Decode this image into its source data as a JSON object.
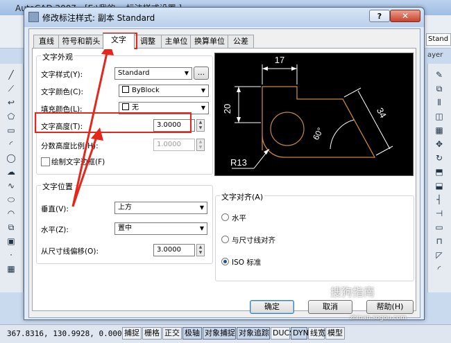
{
  "cad": {
    "title": "AutoCAD 2007 - [E:\\我的... 标注样式设置 ]",
    "coords": "367.8316, 130.9928, 0.0000",
    "status_buttons": [
      "捕捉",
      "栅格",
      "正交",
      "极轴",
      "对象捕捉",
      "对象追踪",
      "DUCS",
      "DYN",
      "线宽",
      "模型"
    ],
    "toolbar_right_label": "Stand",
    "layer_label": "ayer"
  },
  "dialog": {
    "title": "修改标注样式: 副本 Standard",
    "help": "?",
    "close": "✕",
    "tabs": [
      "直线",
      "符号和箭头",
      "文字",
      "调整",
      "主单位",
      "换算单位",
      "公差"
    ],
    "active_tab": "文字",
    "text_appearance": {
      "group": "文字外观",
      "style_label": "文字样式(Y):",
      "style_value": "Standard",
      "style_more": "...",
      "color_label": "文字颜色(C):",
      "color_value": "ByBlock",
      "fill_label": "填充颜色(L):",
      "fill_value": "无",
      "height_label": "文字高度(T):",
      "height_value": "3.0000",
      "fraction_label": "分数高度比例(H):",
      "fraction_value": "1.0000",
      "frame_label": "绘制文字边框(F)"
    },
    "text_placement": {
      "group": "文字位置",
      "vertical_label": "垂直(V):",
      "vertical_value": "上方",
      "horizontal_label": "水平(Z):",
      "horizontal_value": "置中",
      "offset_label": "从尺寸线偏移(O):",
      "offset_value": "3.0000"
    },
    "text_alignment": {
      "group": "文字对齐(A)",
      "options": [
        "水平",
        "与尺寸线对齐",
        "ISO 标准"
      ],
      "selected": "ISO 标准"
    },
    "preview": {
      "dim_17": "17",
      "dim_20": "20",
      "dim_34": "34",
      "dim_60": "60°",
      "dim_r13": "R13"
    },
    "buttons": {
      "ok": "确定",
      "cancel": "取消",
      "help": "帮助(H)"
    }
  },
  "watermark": {
    "text": "搜狗指南",
    "url": "zhinan.sogou.com"
  },
  "colors": {
    "annotation_red": "#e5261b",
    "preview_bg": "#000000",
    "preview_geometry": "#c8893a",
    "preview_dims": "#ffffff"
  }
}
